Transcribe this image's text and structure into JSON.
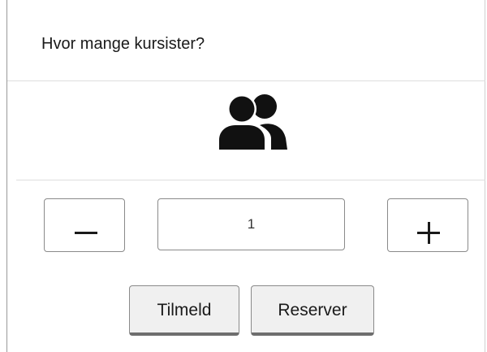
{
  "dialog": {
    "title": "Hvor mange kursister?"
  },
  "icon": {
    "name": "users-icon",
    "color": "#111111"
  },
  "stepper": {
    "decrement_label": "−",
    "increment_label": "+",
    "value": "1"
  },
  "actions": {
    "signup_label": "Tilmeld",
    "reserve_label": "Reserver"
  }
}
